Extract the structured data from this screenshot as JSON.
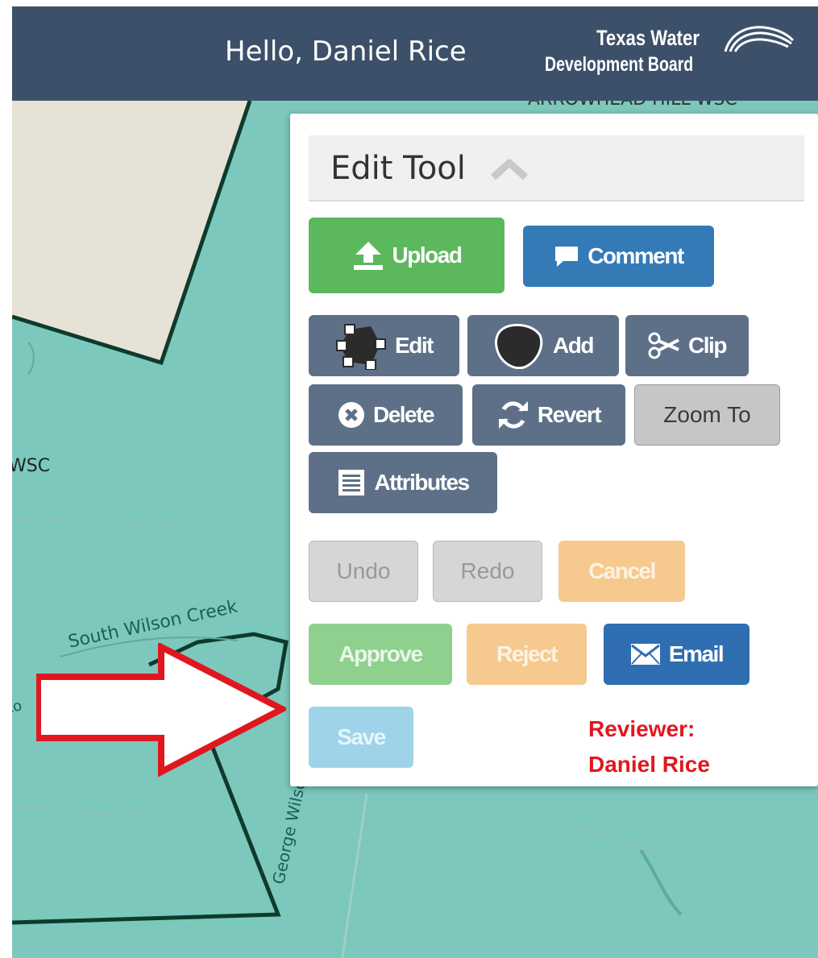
{
  "header": {
    "greeting": "Hello, Daniel Rice",
    "logo_line1": "Texas Water",
    "logo_line2": "Development Board",
    "background_color": "#3c5069"
  },
  "map": {
    "labels": {
      "wsc": "WSC",
      "creek": "South Wilson Creek",
      "road": "George Wilson Rd",
      "top": "ARROWHEAD HILL WSC",
      "left_edge": "to"
    },
    "water_color": "#7cc8bd",
    "parcel_color": "#e6e3d6"
  },
  "panel": {
    "title": "Edit Tool",
    "collapse_icon": "chevron-up-icon",
    "buttons": {
      "upload": "Upload",
      "comment": "Comment",
      "edit": "Edit",
      "add": "Add",
      "clip": "Clip",
      "delete": "Delete",
      "revert": "Revert",
      "zoom_to": "Zoom To",
      "attributes": "Attributes",
      "undo": "Undo",
      "redo": "Redo",
      "cancel": "Cancel",
      "approve": "Approve",
      "reject": "Reject",
      "email": "Email",
      "save": "Save"
    },
    "reviewer_label": "Reviewer:",
    "reviewer_name": "Daniel Rice"
  },
  "annotation": {
    "arrow_color": "#e0171f"
  }
}
